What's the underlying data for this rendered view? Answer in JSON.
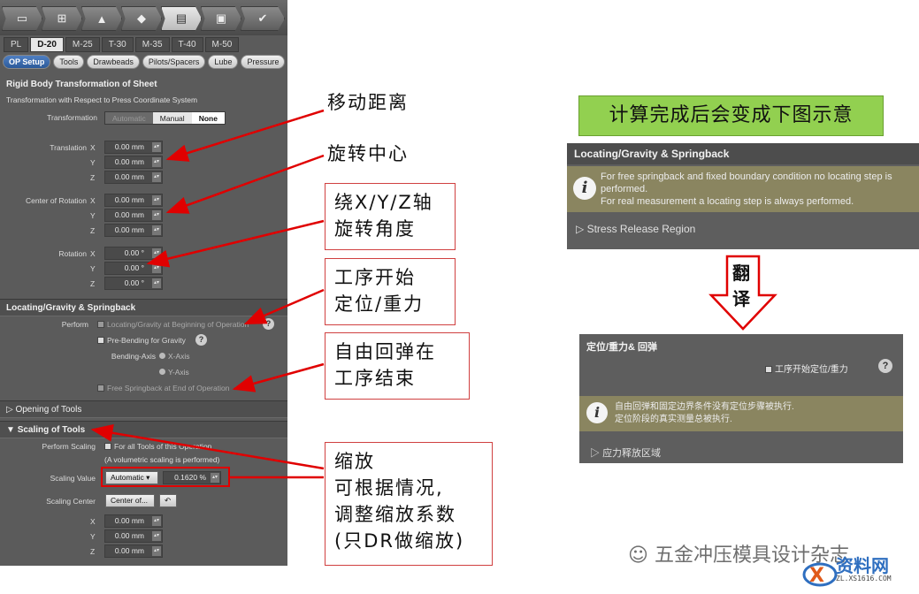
{
  "toolbar": {
    "icons": [
      "blank-icon",
      "tree-icon",
      "punch-icon",
      "sheet-icon",
      "process-icon",
      "monitor-icon",
      "check-icon"
    ]
  },
  "tabs": [
    "PL",
    "D-20",
    "M-25",
    "T-30",
    "M-35",
    "T-40",
    "M-50"
  ],
  "active_tab": "D-20",
  "subtabs": [
    "OP Setup",
    "Tools",
    "Drawbeads",
    "Pilots/Spacers",
    "Lube",
    "Pressure"
  ],
  "rigid": {
    "title": "Rigid Body Transformation of Sheet",
    "subtitle": "Transformation with Respect to Press Coordinate System",
    "transformation_label": "Transformation",
    "modes": [
      "Automatic",
      "Manual",
      "None"
    ],
    "translation_label": "Translation",
    "center_label": "Center of Rotation",
    "rotation_label": "Rotation",
    "axes": [
      "X",
      "Y",
      "Z"
    ],
    "mm_value": "0.00 mm",
    "deg_value": "0.00 °"
  },
  "locating": {
    "title": "Locating/Gravity & Springback",
    "perform_label": "Perform",
    "opt1": "Locating/Gravity at Beginning of Operation",
    "opt2": "Pre-Bending for Gravity",
    "bending_axis_label": "Bending-Axis",
    "x_axis": "X-Axis",
    "y_axis": "Y-Axis",
    "opt3": "Free Springback at End of Operation"
  },
  "opening": {
    "title": "Opening of Tools"
  },
  "scaling": {
    "title": "Scaling of Tools",
    "perform_label": "Perform Scaling",
    "perform_value": "For all Tools of this Operation",
    "note": "(A volumetric scaling is performed)",
    "value_label": "Scaling Value",
    "mode": "Automatic",
    "value": "0.1620 %",
    "center_label": "Scaling Center",
    "center_button": "Center of...",
    "axes": [
      "X",
      "Y",
      "Z"
    ],
    "mm_value": "0.00 mm"
  },
  "callouts": {
    "move": "移动距离",
    "center": "旋转中心",
    "rotate_l1": "绕X/Y/Z轴",
    "rotate_l2": "旋转角度",
    "locate_l1": "工序开始",
    "locate_l2": "定位/重力",
    "spring_l1": "自由回弹在",
    "spring_l2": "工序结束",
    "scale_l1": "缩放",
    "scale_l2": "可根据情况,",
    "scale_l3": "调整缩放系数",
    "scale_l4": "(只DR做缩放)"
  },
  "right": {
    "title": "计算完成后会变成下图示意",
    "en_panel": {
      "header": "Locating/Gravity & Springback",
      "info_l1": "For free springback and fixed boundary condition no locating step is",
      "info_l2": "performed.",
      "info_l3": "For real measurement a locating step is always performed.",
      "stress": "Stress Release Region"
    },
    "arrow_l1": "翻",
    "arrow_l2": "译",
    "cn_panel": {
      "header": "定位/重力& 回弹",
      "checkbox": "工序开始定位/重力",
      "info_l1": "自由回弹和固定边界条件没有定位步骤被执行.",
      "info_l2": "定位阶段的真实测量总被执行.",
      "stress": "应力释放区域"
    }
  },
  "watermark": {
    "text": "五金冲压模具设计杂志",
    "logo": "资料网",
    "logo_sub": "ZL.XS1616.COM"
  },
  "colors": {
    "callout_arrow": "#e00000",
    "green": "#92d050",
    "info_bg": "#8a8560"
  }
}
